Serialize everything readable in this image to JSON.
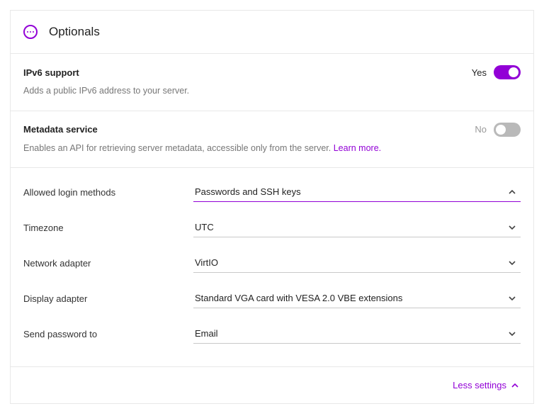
{
  "header": {
    "title": "Optionals"
  },
  "toggles": {
    "ipv6": {
      "label": "IPv6 support",
      "desc": "Adds a public IPv6 address to your server.",
      "state_label": "Yes",
      "enabled": true
    },
    "metadata": {
      "label": "Metadata service",
      "desc_pre": "Enables an API for retrieving server metadata, accessible only from the server. ",
      "learn": "Learn more.",
      "state_label": "No",
      "enabled": false
    }
  },
  "selects": {
    "login": {
      "label": "Allowed login methods",
      "value": "Passwords and SSH keys",
      "expanded": true
    },
    "timezone": {
      "label": "Timezone",
      "value": "UTC",
      "expanded": false
    },
    "network": {
      "label": "Network adapter",
      "value": "VirtIO",
      "expanded": false
    },
    "display": {
      "label": "Display adapter",
      "value": "Standard VGA card with VESA 2.0 VBE extensions",
      "expanded": false
    },
    "password": {
      "label": "Send password to",
      "value": "Email",
      "expanded": false
    }
  },
  "footer": {
    "less": "Less settings"
  }
}
